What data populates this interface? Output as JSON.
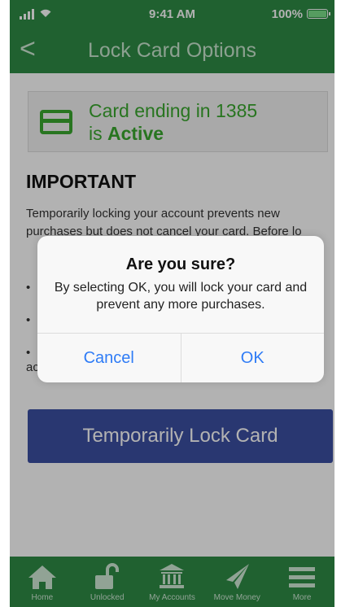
{
  "status": {
    "time": "9:41 AM",
    "battery": "100%",
    "battery_level": 1.0
  },
  "nav": {
    "title": "Lock Card Options",
    "back_glyph": "<"
  },
  "card": {
    "line1": "Card ending in 1385",
    "line2_prefix": "is ",
    "line2_status": "Active"
  },
  "important": {
    "heading": "IMPORTANT",
    "text": "Temporarily locking your account prevents new purchases but does not cancel your card. Before lo",
    "bullets": [
      "•",
      "•",
      "•"
    ],
    "trailing": "ac"
  },
  "lock_button": {
    "label": "Temporarily Lock Card"
  },
  "tabbar": {
    "items": [
      {
        "label": "Home",
        "icon": "home-icon"
      },
      {
        "label": "Unlocked",
        "icon": "unlocked-icon"
      },
      {
        "label": "My Accounts",
        "icon": "bank-icon"
      },
      {
        "label": "Move Money",
        "icon": "paper-plane-icon"
      },
      {
        "label": "More",
        "icon": "menu-icon"
      }
    ]
  },
  "dialog": {
    "title": "Are you sure?",
    "message": "By selecting OK, you will lock your card and prevent any more purchases.",
    "cancel": "Cancel",
    "ok": "OK"
  },
  "colors": {
    "header": "#2e8b46",
    "active": "#3aa82f",
    "button": "#3c50a2",
    "link": "#2f7cf6"
  }
}
